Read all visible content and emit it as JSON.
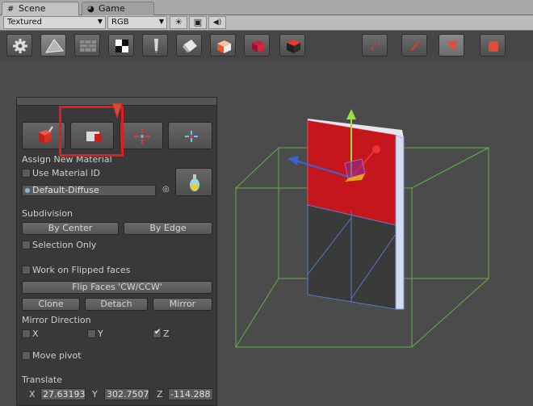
{
  "tabs": [
    {
      "label": "Scene",
      "icon": "grid-icon"
    },
    {
      "label": "Game",
      "icon": "pacman-icon"
    }
  ],
  "scene_toolbar": {
    "render_mode": "Textured",
    "color_mode": "RGB",
    "sun_icon": "☀",
    "image_icon": "▣",
    "audio_icon": "◀)"
  },
  "panel": {
    "assign_header": "Assign New Material",
    "use_material_id": "Use Material ID",
    "material": "Default-Diffuse",
    "subdivision_header": "Subdivision",
    "by_center": "By Center",
    "by_edge": "By Edge",
    "selection_only": "Selection Only",
    "work_on_flipped": "Work on Flipped faces",
    "flip_faces": "Flip Faces 'CW/CCW'",
    "clone": "Clone",
    "detach": "Detach",
    "mirror": "Mirror",
    "mirror_direction_header": "Mirror Direction",
    "axis_x": "X",
    "axis_y": "Y",
    "axis_z": "Z",
    "axis_x_checked": false,
    "axis_y_checked": false,
    "axis_z_checked": true,
    "move_pivot": "Move pivot",
    "translate_header": "Translate",
    "tx_label": "X",
    "ty_label": "Y",
    "tz_label": "Z",
    "tx_value": "27.63193",
    "ty_value": "302.7507",
    "tz_value": "-114.288"
  },
  "colors": {
    "highlight": "#e51b24",
    "mesh_red": "#c4161c",
    "gizmo_green": "#9adf3c",
    "gizmo_blue": "#3b63d6"
  }
}
